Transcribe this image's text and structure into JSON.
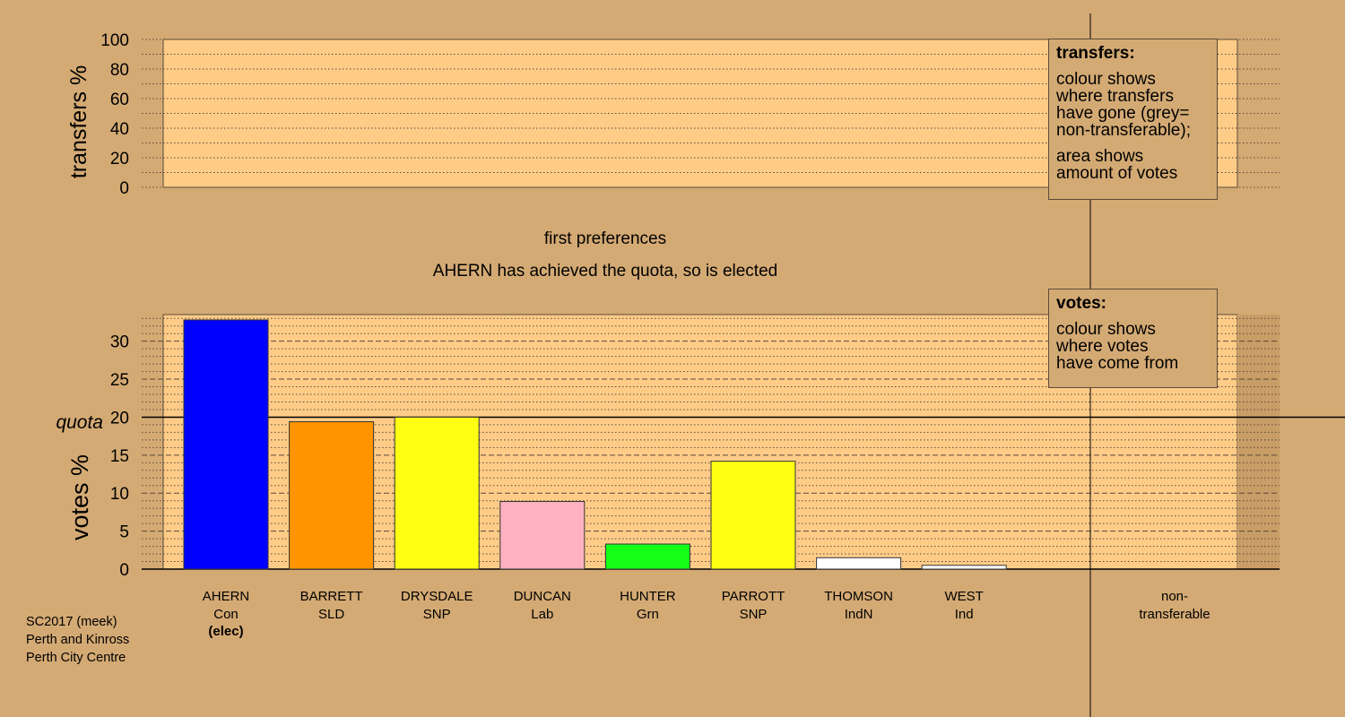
{
  "chart_data": [
    {
      "type": "bar",
      "panel": "transfers",
      "ylabel": "transfers %",
      "ylim": [
        0,
        100
      ],
      "yticks": [
        0,
        20,
        40,
        60,
        80,
        100
      ],
      "grid": true,
      "series": []
    },
    {
      "type": "bar",
      "panel": "votes",
      "ylabel": "votes %",
      "ylim": [
        0,
        33.5
      ],
      "yticks": [
        0,
        5,
        10,
        15,
        20,
        25,
        30
      ],
      "grid": true,
      "quota": 20,
      "quota_label": "quota",
      "categories": [
        "AHERN",
        "BARRETT",
        "DRYSDALE",
        "DUNCAN",
        "HUNTER",
        "PARROTT",
        "THOMSON",
        "WEST"
      ],
      "parties": [
        "Con",
        "SLD",
        "SNP",
        "Lab",
        "Grn",
        "SNP",
        "IndN",
        "Ind"
      ],
      "notes": [
        "(elec)",
        "",
        "",
        "",
        "",
        "",
        "",
        ""
      ],
      "values": [
        32.8,
        19.4,
        20.0,
        8.9,
        3.3,
        14.2,
        1.5,
        0.5
      ],
      "colors": [
        "#0000ff",
        "#ff9400",
        "#ffff14",
        "#ffb2c2",
        "#16ff16",
        "#ffff14",
        "#ffffff",
        "#ffffff"
      ],
      "extra_category": "non-\ntransferable"
    }
  ],
  "stage_title": "first preferences",
  "stage_subtitle": "AHERN has achieved the quota, so is elected",
  "legend_transfers": {
    "heading": "transfers:",
    "line1": "colour shows",
    "line2": "where transfers",
    "line3": "have gone (grey=",
    "line4": "non-transferable);",
    "line5": "area shows",
    "line6": "amount of votes"
  },
  "legend_votes": {
    "heading": "votes:",
    "line1": "colour shows",
    "line2": "where votes",
    "line3": "have come from"
  },
  "credits": {
    "line1": "SC2017 (meek)",
    "line2": "Perth and Kinross",
    "line3": "Perth City Centre"
  },
  "colors": {
    "background": "#d4aa74",
    "plot_fill": "#ffcc88",
    "axis": "#000000"
  }
}
